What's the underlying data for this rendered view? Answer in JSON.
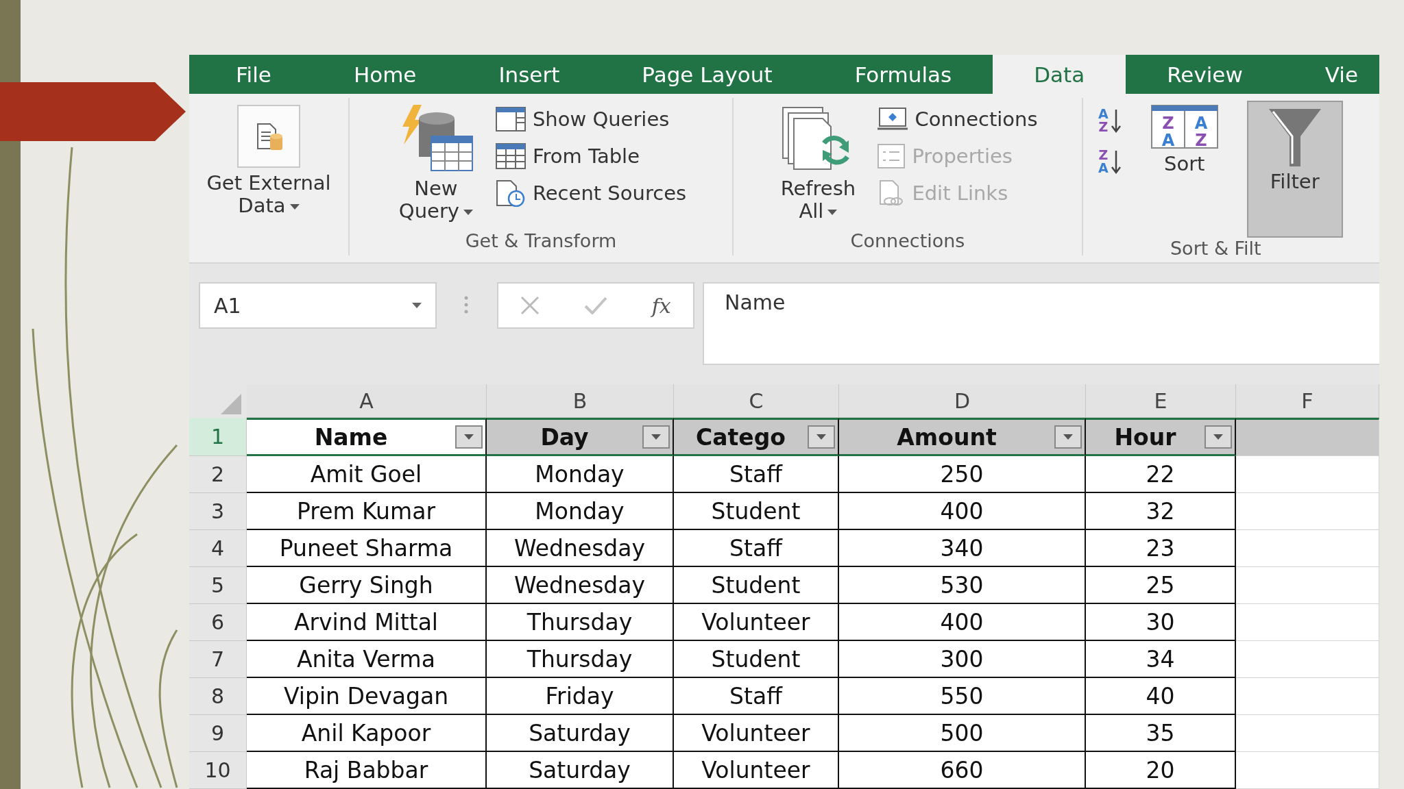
{
  "tabs": [
    {
      "label": "File",
      "selected": false
    },
    {
      "label": "Home",
      "selected": false
    },
    {
      "label": "Insert",
      "selected": false
    },
    {
      "label": "Page Layout",
      "selected": false
    },
    {
      "label": "Formulas",
      "selected": false
    },
    {
      "label": "Data",
      "selected": true
    },
    {
      "label": "Review",
      "selected": false
    },
    {
      "label": "Vie",
      "selected": false
    }
  ],
  "ribbon": {
    "groups": [
      {
        "items": [
          {
            "kind": "large",
            "lines": [
              "Get External",
              "Data"
            ],
            "dropdown": true,
            "pressed": false
          }
        ]
      },
      {
        "label": "Get & Transform",
        "items": [
          {
            "kind": "large",
            "lines": [
              "New",
              "Query"
            ],
            "dropdown": true,
            "pressed": false
          },
          {
            "kind": "stack",
            "entries": [
              {
                "label": "Show Queries",
                "disabled": false
              },
              {
                "label": "From Table",
                "disabled": false
              },
              {
                "label": "Recent Sources",
                "disabled": false
              }
            ]
          }
        ]
      },
      {
        "label": "Connections",
        "items": [
          {
            "kind": "large",
            "lines": [
              "Refresh",
              "All"
            ],
            "dropdown": true,
            "pressed": false
          },
          {
            "kind": "stack",
            "entries": [
              {
                "label": "Connections",
                "disabled": false
              },
              {
                "label": "Properties",
                "disabled": true
              },
              {
                "label": "Edit Links",
                "disabled": true
              }
            ]
          }
        ]
      },
      {
        "label": "Sort & Filt",
        "items": [
          {
            "kind": "sort_pair",
            "buttons": [
              [
                "A",
                "Z"
              ],
              [
                "Z",
                "A"
              ]
            ]
          },
          {
            "kind": "large",
            "lines": [
              "Sort"
            ],
            "dropdown": false,
            "pressed": false,
            "icon_letters": [
              "Z",
              "A",
              "A",
              "Z"
            ]
          },
          {
            "kind": "large",
            "lines": [
              "Filter"
            ],
            "dropdown": false,
            "pressed": true
          }
        ]
      }
    ]
  },
  "formula_bar": {
    "name_box": "A1",
    "function_label": "fx",
    "formula": "Name"
  },
  "sheet": {
    "columns": [
      "A",
      "B",
      "C",
      "D",
      "E",
      "F"
    ],
    "rows": [
      {
        "number": "1",
        "kind": "header",
        "selected": true,
        "cells": [
          {
            "text": "Name",
            "active": true,
            "filter": true
          },
          {
            "text": "Day",
            "active": false,
            "filter": true
          },
          {
            "text": "Catego",
            "active": false,
            "filter": true
          },
          {
            "text": "Amount",
            "active": false,
            "filter": true
          },
          {
            "text": "Hour",
            "active": false,
            "filter": true
          }
        ]
      },
      {
        "number": "2",
        "kind": "data",
        "selected": false,
        "cells": [
          "Amit Goel",
          "Monday",
          "Staff",
          "250",
          "22"
        ]
      },
      {
        "number": "3",
        "kind": "data",
        "selected": false,
        "cells": [
          "Prem Kumar",
          "Monday",
          "Student",
          "400",
          "32"
        ]
      },
      {
        "number": "4",
        "kind": "data",
        "selected": false,
        "cells": [
          "Puneet Sharma",
          "Wednesday",
          "Staff",
          "340",
          "23"
        ]
      },
      {
        "number": "5",
        "kind": "data",
        "selected": false,
        "cells": [
          "Gerry Singh",
          "Wednesday",
          "Student",
          "530",
          "25"
        ]
      },
      {
        "number": "6",
        "kind": "data",
        "selected": false,
        "cells": [
          "Arvind Mittal",
          "Thursday",
          "Volunteer",
          "400",
          "30"
        ]
      },
      {
        "number": "7",
        "kind": "data",
        "selected": false,
        "cells": [
          "Anita Verma",
          "Thursday",
          "Student",
          "300",
          "34"
        ]
      },
      {
        "number": "8",
        "kind": "data",
        "selected": false,
        "cells": [
          "Vipin Devagan",
          "Friday",
          "Staff",
          "550",
          "40"
        ]
      },
      {
        "number": "9",
        "kind": "data",
        "selected": false,
        "cells": [
          "Anil Kapoor",
          "Saturday",
          "Volunteer",
          "500",
          "35"
        ]
      },
      {
        "number": "10",
        "kind": "data",
        "selected": false,
        "cells": [
          "Raj Babbar",
          "Saturday",
          "Volunteer",
          "660",
          "20"
        ]
      }
    ]
  }
}
